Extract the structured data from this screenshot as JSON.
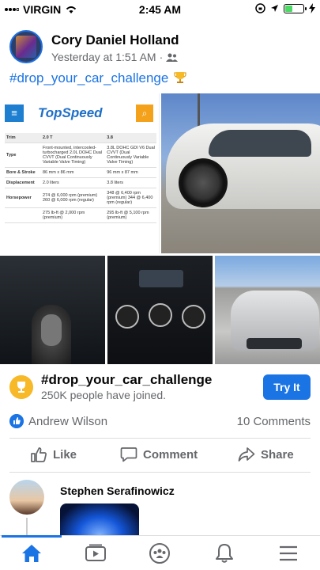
{
  "status_bar": {
    "carrier": "VIRGIN",
    "time": "2:45 AM"
  },
  "post": {
    "author": "Cory Daniel Holland",
    "timestamp": "Yesterday at 1:51 AM",
    "separator": "·",
    "hashtag": "#drop_your_car_challenge",
    "photo_grid": {
      "spec_card": {
        "logo": "TopSpeed",
        "header": {
          "k": "Trim",
          "a": "2.0 T",
          "b": "3.8"
        },
        "rows": [
          {
            "k": "Type",
            "a": "Front-mounted, intercooled-turbocharged 2.0L DOHC Dual CVVT (Dual Continuously Variable Valve Timing)",
            "b": "3.8L DOHC GDI V6 Dual CVVT (Dual Continuously Variable Valve Timing)"
          },
          {
            "k": "Bore & Stroke",
            "a": "86 mm x 86 mm",
            "b": "96 mm x 87 mm"
          },
          {
            "k": "Displacement",
            "a": "2.0 liters",
            "b": "3.8 liters"
          },
          {
            "k": "Horsepower",
            "a": "274 @ 6,000 rpm (premium) 260 @ 6,000 rpm (regular)",
            "b": "348 @ 6,400 rpm (premium) 344 @ 6,400 rpm (regular)"
          },
          {
            "k": "",
            "a": "275 lb-ft @ 2,000 rpm (premium)",
            "b": "295 lb-ft @ 5,100 rpm (premium)"
          }
        ]
      }
    }
  },
  "challenge": {
    "title": "#drop_your_car_challenge",
    "subtitle": "250K people have joined.",
    "button": "Try It"
  },
  "reactions": {
    "reactor": "Andrew Wilson",
    "comments": "10 Comments"
  },
  "actions": {
    "like": "Like",
    "comment": "Comment",
    "share": "Share"
  },
  "comment": {
    "author": "Stephen Serafinowicz"
  },
  "colors": {
    "accent": "#1b74e4",
    "muted": "#65676b",
    "trophy": "#f7b928"
  }
}
